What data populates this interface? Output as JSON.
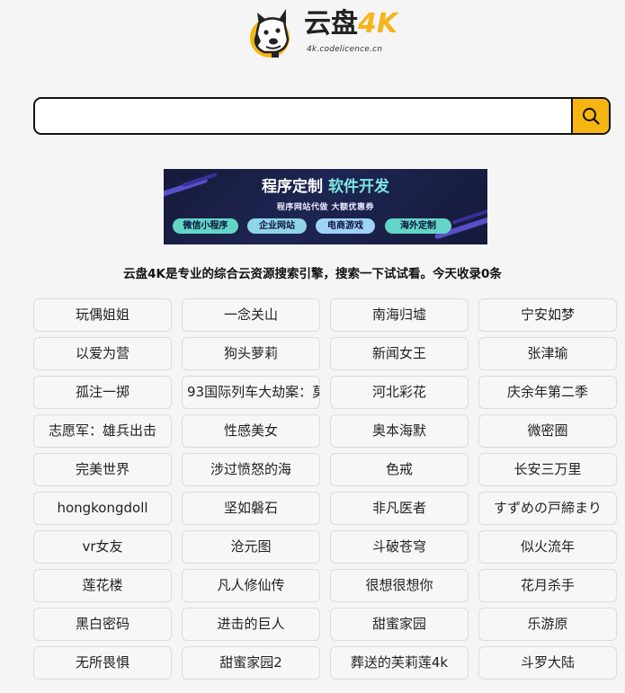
{
  "logo": {
    "brand_cn": "云盘",
    "brand_4k": "4K",
    "domain": "4k.codelicence.cn",
    "accent_color": "#f5b41a"
  },
  "search": {
    "value": "",
    "placeholder": "",
    "button_icon": "search-icon",
    "button_color": "#f6b611"
  },
  "banner": {
    "title_white": "程序定制",
    "title_accent": "软件开发",
    "subtitle": "程序网站代做  大额优惠券",
    "pills": [
      "微信小程序",
      "企业网站",
      "电商游戏",
      "海外定制"
    ]
  },
  "tagline": "云盘4K是专业的综合云资源搜索引擎，搜索一下试试看。今天收录0条",
  "keywords": [
    [
      "玩偶姐姐",
      "一念关山",
      "南海归墟",
      "宁安如梦"
    ],
    [
      "以爱为营",
      "狗头萝莉",
      "新闻女王",
      "张津瑜"
    ],
    [
      "孤注一掷",
      "93国际列车大劫案：莫",
      "河北彩花",
      "庆余年第二季"
    ],
    [
      "志愿军：雄兵出击",
      "性感美女",
      "奥本海默",
      "微密圈"
    ],
    [
      "完美世界",
      "涉过愤怒的海",
      "色戒",
      "长安三万里"
    ],
    [
      "hongkongdoll",
      "坚如磐石",
      "非凡医者",
      "すずめの戸締まり"
    ],
    [
      "vr女友",
      "沧元图",
      "斗破苍穹",
      "似火流年"
    ],
    [
      "莲花楼",
      "凡人修仙传",
      "很想很想你",
      "花月杀手"
    ],
    [
      "黑白密码",
      "进击的巨人",
      "甜蜜家园",
      "乐游原"
    ],
    [
      "无所畏惧",
      "甜蜜家园2",
      "葬送的芙莉莲4k",
      "斗罗大陆"
    ]
  ]
}
